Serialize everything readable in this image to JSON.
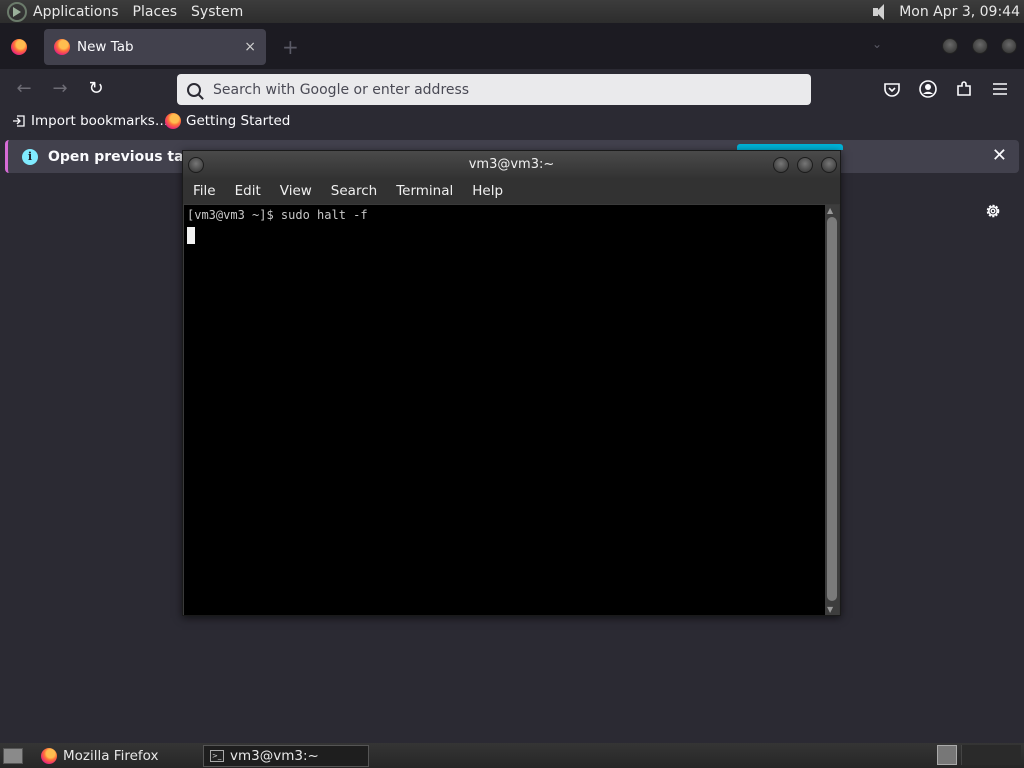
{
  "top_panel": {
    "menus": [
      "Applications",
      "Places",
      "System"
    ],
    "clock": "Mon Apr  3, 09:44"
  },
  "firefox": {
    "tab_title": "New Tab",
    "tab_close": "×",
    "new_tab": "+",
    "urlbar_placeholder": "Search with Google or enter address",
    "bookmarks": [
      "Import bookmarks…",
      "Getting Started"
    ],
    "infobar_text": "Open previous tabs? ",
    "infobar_close": "✕",
    "accent_color": "#00b3d9"
  },
  "terminal": {
    "title": "vm3@vm3:~",
    "menus": [
      "File",
      "Edit",
      "View",
      "Search",
      "Terminal",
      "Help"
    ],
    "line": "[vm3@vm3 ~]$ sudo halt -f"
  },
  "taskbar": {
    "items": [
      "Mozilla Firefox",
      "vm3@vm3:~"
    ]
  }
}
